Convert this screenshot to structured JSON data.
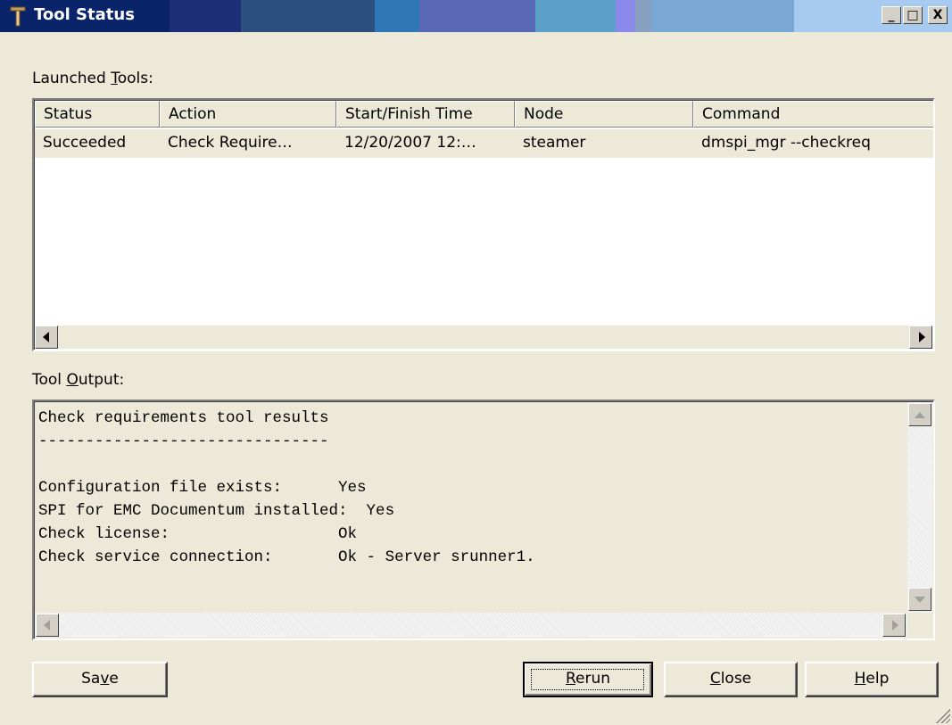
{
  "window": {
    "title": "Tool Status",
    "controls": {
      "minimize": "_",
      "maximize": "□",
      "close": "X"
    }
  },
  "launched": {
    "label_pre": "Launched ",
    "label_accel": "T",
    "label_post": "ools:",
    "columns": [
      "Status",
      "Action",
      "Start/Finish Time",
      "Node",
      "Command"
    ],
    "rows": [
      {
        "status": "Succeeded",
        "action": "Check Require…",
        "time": "12/20/2007 12:…",
        "node": "steamer",
        "command": "dmspi_mgr --checkreq"
      }
    ]
  },
  "output": {
    "label_pre": "Tool ",
    "label_accel": "O",
    "label_post": "utput:",
    "lines": [
      "Check requirements tool results",
      "-------------------------------",
      "",
      "Configuration file exists:      Yes",
      "SPI for EMC Documentum installed:  Yes",
      "Check license:                  Ok",
      "Check service connection:       Ok - Server srunner1."
    ]
  },
  "buttons": {
    "save": {
      "pre": "Sa",
      "accel": "v",
      "post": "e"
    },
    "rerun": {
      "pre": "",
      "accel": "R",
      "post": "erun"
    },
    "close": {
      "pre": "",
      "accel": "C",
      "post": "lose"
    },
    "help": {
      "pre": "",
      "accel": "H",
      "post": "elp"
    }
  }
}
